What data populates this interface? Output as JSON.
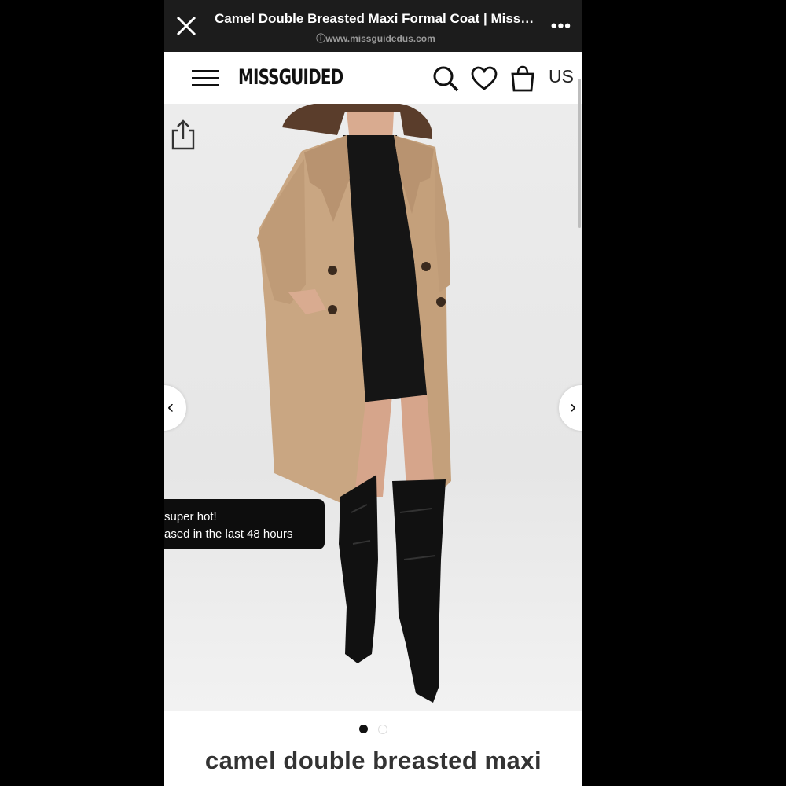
{
  "browser": {
    "title": "Camel Double Breasted Maxi Formal Coat | Missguided",
    "url": "ⓘwww.missguidedus.com",
    "close_icon": "close-icon",
    "more_icon": "more-icon",
    "more_label": "•••"
  },
  "header": {
    "brand": "MISSGUIDED",
    "locale": "US",
    "icons": [
      "menu-icon",
      "search-icon",
      "heart-icon",
      "bag-icon"
    ]
  },
  "gallery": {
    "prev_label": "‹",
    "next_label": "›",
    "toast_line1": "super hot!",
    "toast_line2": "ased in the last 48 hours",
    "active_index": 0,
    "total": 2
  },
  "product": {
    "title": "camel double breasted maxi"
  },
  "colors": {
    "coat": "#c9a682",
    "dark": "#111111",
    "topbar": "#1c1c1c"
  }
}
